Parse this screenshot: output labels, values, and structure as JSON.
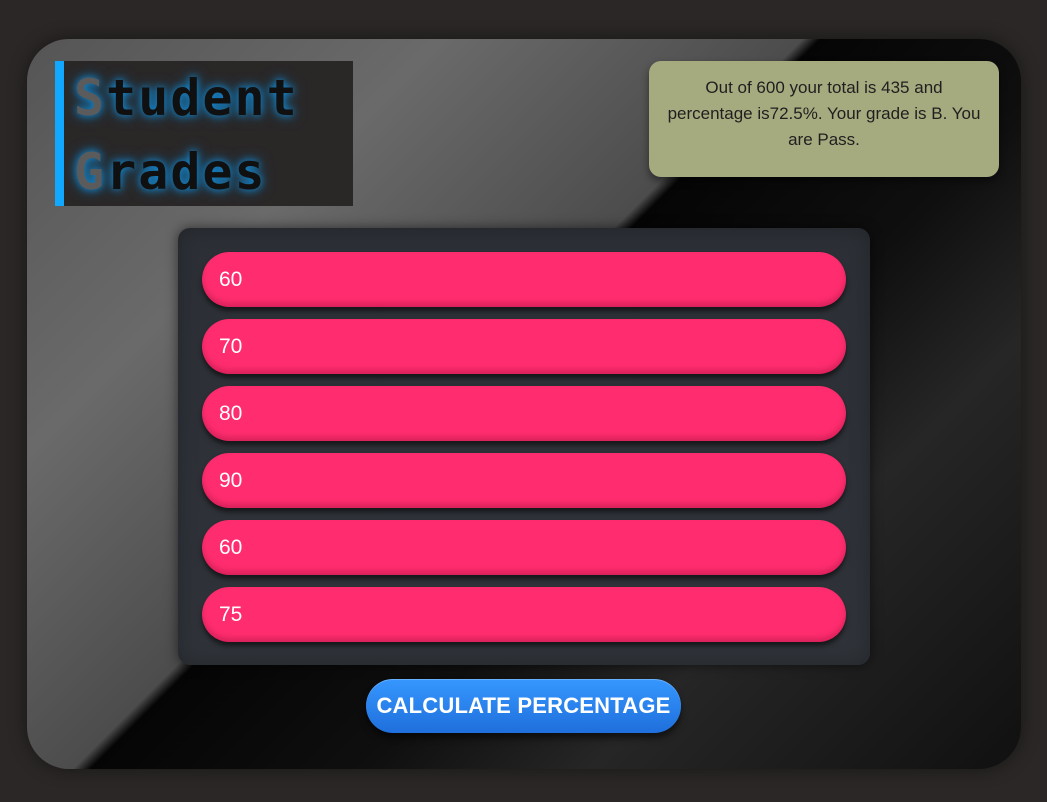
{
  "title": {
    "line1_initial": "S",
    "line1_rest": "tudent",
    "line2_initial": "G",
    "line2_rest": "rades"
  },
  "result": {
    "text": "Out of 600 your total is 435 and percentage is72.5%. Your grade is B. You are Pass."
  },
  "marks": [
    "60",
    "70",
    "80",
    "90",
    "60",
    "75"
  ],
  "button": {
    "label": "CALCULATE PERCENTAGE"
  },
  "colors": {
    "accent_blue": "#10a9ff",
    "result_bg": "#a6ab7f",
    "input_pink": "#ff2d6f",
    "button_blue": "#2b82ee",
    "panel_bg": "#2f3339"
  }
}
